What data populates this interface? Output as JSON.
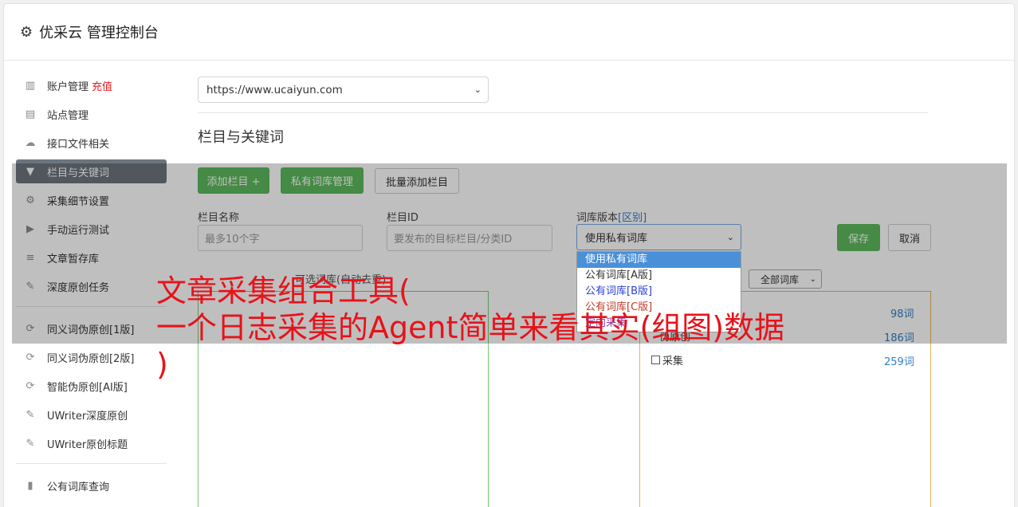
{
  "header": {
    "title": "优采云 管理控制台",
    "icon": "gear-icon"
  },
  "sidebar": {
    "items": [
      {
        "label": "账户管理",
        "badge": "充值",
        "icon": "bar-chart-icon"
      },
      {
        "label": "站点管理",
        "icon": "server-icon"
      },
      {
        "label": "接口文件相关",
        "icon": "cloud-upload-icon"
      },
      {
        "label": "栏目与关键词",
        "icon": "filter-icon",
        "active": true
      },
      {
        "label": "采集细节设置",
        "icon": "cogs-icon"
      },
      {
        "label": "手动运行测试",
        "icon": "play-circle-icon"
      },
      {
        "label": "文章暂存库",
        "icon": "database-icon"
      },
      {
        "label": "深度原创任务",
        "icon": "edit-icon"
      }
    ],
    "items2": [
      {
        "label": "同义词伪原创[1版]",
        "icon": "refresh-icon"
      },
      {
        "label": "同义词伪原创[2版]",
        "icon": "refresh-icon"
      },
      {
        "label": "智能伪原创[AI版]",
        "icon": "refresh-icon"
      },
      {
        "label": "UWriter深度原创",
        "icon": "edit-icon"
      },
      {
        "label": "UWriter原创标题",
        "icon": "edit-icon"
      }
    ],
    "items3": [
      {
        "label": "公有词库查询",
        "icon": "book-icon"
      }
    ]
  },
  "main": {
    "site_select": "https://www.ucaiyun.com",
    "section_title": "栏目与关键词",
    "buttons": {
      "add_column": "添加栏目 +",
      "private_lib": "私有词库管理",
      "batch_add": "批量添加栏目",
      "save": "保存",
      "cancel": "取消"
    },
    "fields": {
      "name_label": "栏目名称",
      "name_placeholder": "最多10个字",
      "id_label": "栏目ID",
      "id_placeholder": "要发布的目标栏目/分类ID",
      "version_label": "词库版本",
      "version_diff": "[区别]",
      "version_value": "使用私有词库"
    },
    "dropdown_options": [
      {
        "label": "使用私有词库",
        "color": "#ffffff"
      },
      {
        "label": "公有词库[A版]",
        "color": "#333333"
      },
      {
        "label": "公有词库[B版]",
        "color": "#2b3fd6"
      },
      {
        "label": "公有词库[C版]",
        "color": "#c0392b"
      },
      {
        "label": "定向采集",
        "color": "#8e44ad"
      }
    ],
    "word_box_label": "可选词库(自动去重)",
    "lib_filter": "全部词库",
    "right_list": [
      {
        "name": "",
        "count": "98词"
      },
      {
        "name": "伪原创",
        "count": "186词"
      },
      {
        "name": "采集",
        "count": "259词"
      }
    ]
  },
  "watermark": {
    "line1": "文章采集组合工具(",
    "line2": "一个日志采集的Agent简单来看其实(组图)数据",
    "line3": ")"
  }
}
